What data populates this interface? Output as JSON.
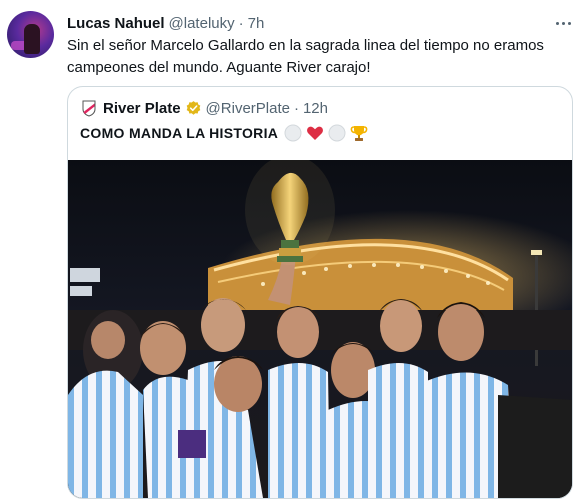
{
  "tweet": {
    "author_name": "Lucas Nahuel",
    "author_handle": "@lateluky",
    "separator": "·",
    "timestamp": "7h",
    "text": "Sin el señor Marcelo Gallardo en la sagrada linea del tiempo no eramos campeones del mundo. Aguante River carajo!"
  },
  "quoted": {
    "author_name": "River Plate",
    "author_handle": "@RiverPlate",
    "separator": "·",
    "timestamp": "12h",
    "text": "COMO MANDA LA HISTORIA",
    "emojis": [
      "white-circle",
      "red-heart",
      "white-circle",
      "trophy"
    ],
    "image_icon": "team-celebration-with-trophy-photo"
  },
  "colors": {
    "text_primary": "#0f1419",
    "text_secondary": "#536471",
    "border": "#cfd9de",
    "verified_gold": "#e2b719",
    "heart_red": "#e0245e"
  }
}
